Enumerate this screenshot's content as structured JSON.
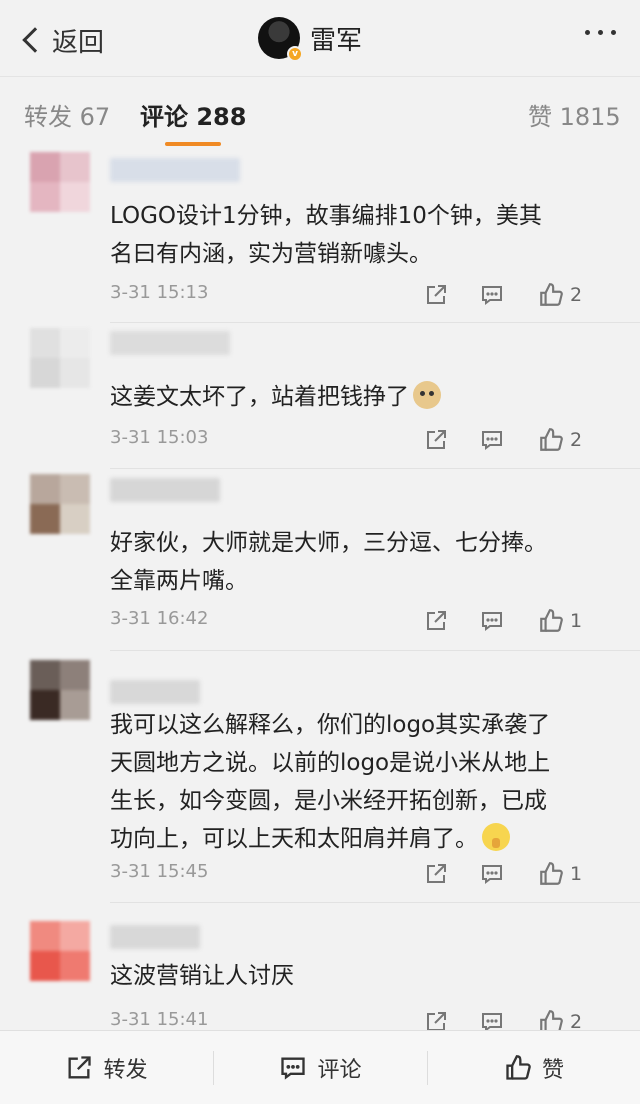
{
  "nav": {
    "back_label": "返回",
    "user_name": "雷军"
  },
  "tabs": [
    {
      "label": "转发 67"
    },
    {
      "label": "评论 288"
    },
    {
      "label": "赞 1815"
    }
  ],
  "comments": [
    {
      "text": "LOGO设计1分钟，故事编排10个钟，美其\n名曰有内涵，实为营销新噱头。",
      "time": "3-31 15:13",
      "likes": "2"
    },
    {
      "text": "这姜文太坏了，站着把钱挣了",
      "emoji": "doge-icon",
      "time": "3-31 15:03",
      "likes": "2"
    },
    {
      "text": "好家伙，大师就是大师，三分逗、七分捧。\n全靠两片嘴。",
      "time": "3-31 16:42",
      "likes": "1"
    },
    {
      "text": "我可以这么解释么，你们的logo其实承袭了\n天圆地方之说。以前的logo是说小米从地上\n生长，如今变圆，是小米经开拓创新，已成\n功向上，可以上天和太阳肩并肩了。",
      "emoji": "shush-icon",
      "time": "3-31 15:45",
      "likes": "1"
    },
    {
      "text": "这波营销让人讨厌",
      "time": "3-31 15:41",
      "likes": "2"
    }
  ],
  "bottom_bar": {
    "repost_label": "转发",
    "comment_label": "评论",
    "like_label": "赞"
  },
  "colors": {
    "accent_underline": "#f08a24",
    "verified_badge": "#f5a623"
  }
}
